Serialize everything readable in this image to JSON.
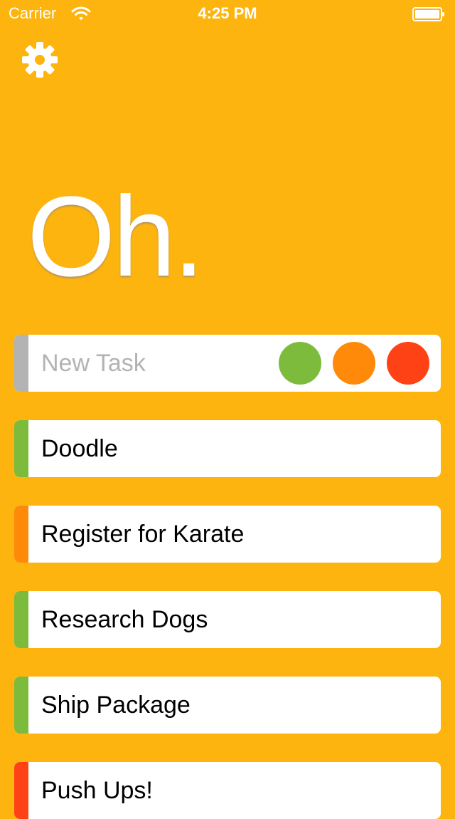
{
  "status_bar": {
    "carrier": "Carrier",
    "time": "4:25 PM",
    "wifi_icon": "wifi-icon",
    "battery_icon": "battery-icon"
  },
  "settings_icon": "gear-icon",
  "title": "Oh.",
  "colors": {
    "background": "#FDB40E",
    "green": "#7DBB3C",
    "orange": "#FF8A0A",
    "red": "#FF4216",
    "placeholder_strip": "#B3B3B3"
  },
  "new_task": {
    "placeholder": "New Task",
    "priority_options": [
      "green",
      "orange",
      "red"
    ]
  },
  "tasks": [
    {
      "label": "Doodle",
      "priority": "green"
    },
    {
      "label": "Register for Karate",
      "priority": "orange"
    },
    {
      "label": "Research Dogs",
      "priority": "green"
    },
    {
      "label": "Ship Package",
      "priority": "green"
    },
    {
      "label": "Push Ups!",
      "priority": "red"
    }
  ]
}
